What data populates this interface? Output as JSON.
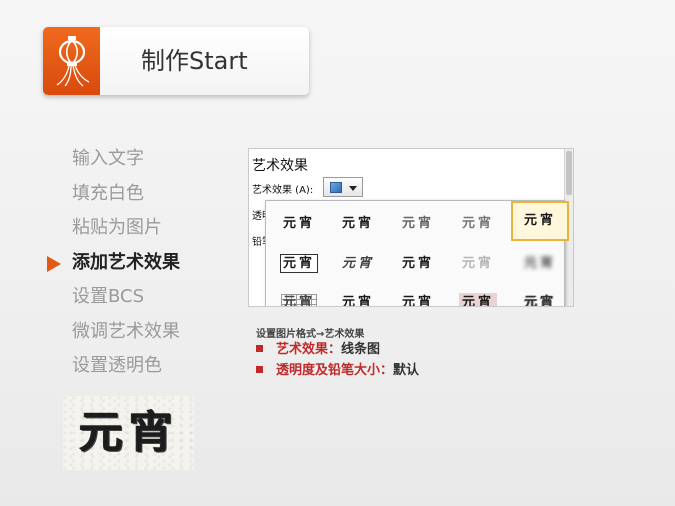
{
  "header": {
    "title": "制作Start",
    "icon": "lantern-icon"
  },
  "steps": [
    {
      "label": "输入文字",
      "active": false
    },
    {
      "label": "填充白色",
      "active": false
    },
    {
      "label": "粘贴为图片",
      "active": false
    },
    {
      "label": "添加艺术效果",
      "active": true
    },
    {
      "label": "设置BCS",
      "active": false
    },
    {
      "label": "微调艺术效果",
      "active": false
    },
    {
      "label": "设置透明色",
      "active": false
    }
  ],
  "sample": {
    "text": "元宵"
  },
  "dialog": {
    "title": "艺术效果",
    "effect_label": "艺术效果 (A):",
    "cut_label_1": "透明",
    "cut_label_2": "铅笔",
    "thumb_text": "元宵"
  },
  "caption": "设置图片格式→艺术效果",
  "bullets": [
    {
      "key": "艺术效果",
      "sep": "：",
      "value": "线条图"
    },
    {
      "key": "透明度及铅笔大小",
      "sep": "：",
      "value": "默认"
    }
  ],
  "colors": {
    "accent": "#e25a12",
    "bullet_red": "#c0292b",
    "icon_orange": "#f06a1e"
  }
}
